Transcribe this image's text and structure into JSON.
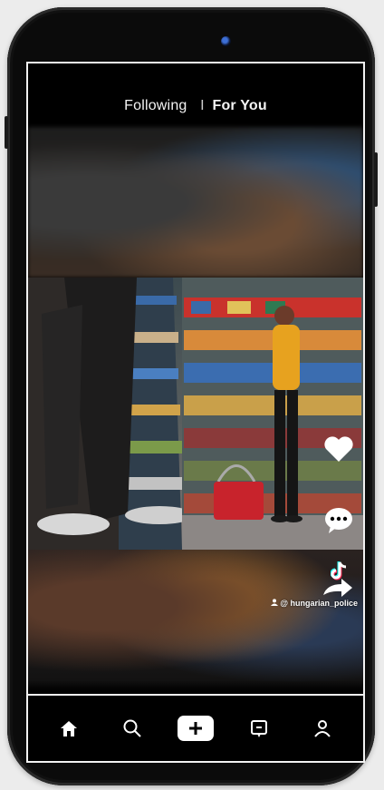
{
  "top_tabs": {
    "following": "Following",
    "separator": "I",
    "for_you": "For You"
  },
  "video": {
    "author_handle": "@ hungarian_police"
  },
  "actions": {
    "like": "heart-icon",
    "comment": "comment-icon",
    "tiktok": "tiktok-logo-icon",
    "share": "share-icon"
  },
  "bottom_nav": {
    "items": [
      "home-icon",
      "search-icon",
      "create-icon",
      "inbox-icon",
      "profile-icon"
    ]
  },
  "colors": {
    "screen_bg": "#000000",
    "cardigan": "#e7a21f",
    "basket": "#c8232c"
  }
}
